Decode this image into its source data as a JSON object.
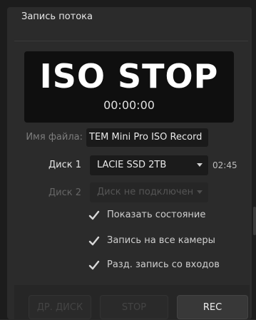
{
  "panel": {
    "title": "Запись потока"
  },
  "display": {
    "status": "ISO STOP",
    "timecode": "00:00:00"
  },
  "file": {
    "label": "Имя файла:",
    "value": "TEM Mini Pro ISO Record"
  },
  "disk1": {
    "label": "Диск 1",
    "value": "LACIE SSD 2TB",
    "duration": "02:45"
  },
  "disk2": {
    "label": "Диск 2",
    "value": "Диск не подключен"
  },
  "options": [
    {
      "label": "Показать состояние",
      "checked": true
    },
    {
      "label": "Запись на все камеры",
      "checked": true
    },
    {
      "label": "Разд. запись со входов",
      "checked": true
    }
  ],
  "buttons": {
    "other_disk": "ДР. ДИСК",
    "stop": "STOP",
    "rec": "REC"
  },
  "colors": {
    "panel_bg": "#2b2b2b",
    "display_bg": "#0f0f0f",
    "text": "#e6e6e6",
    "disabled_text": "#555555"
  }
}
